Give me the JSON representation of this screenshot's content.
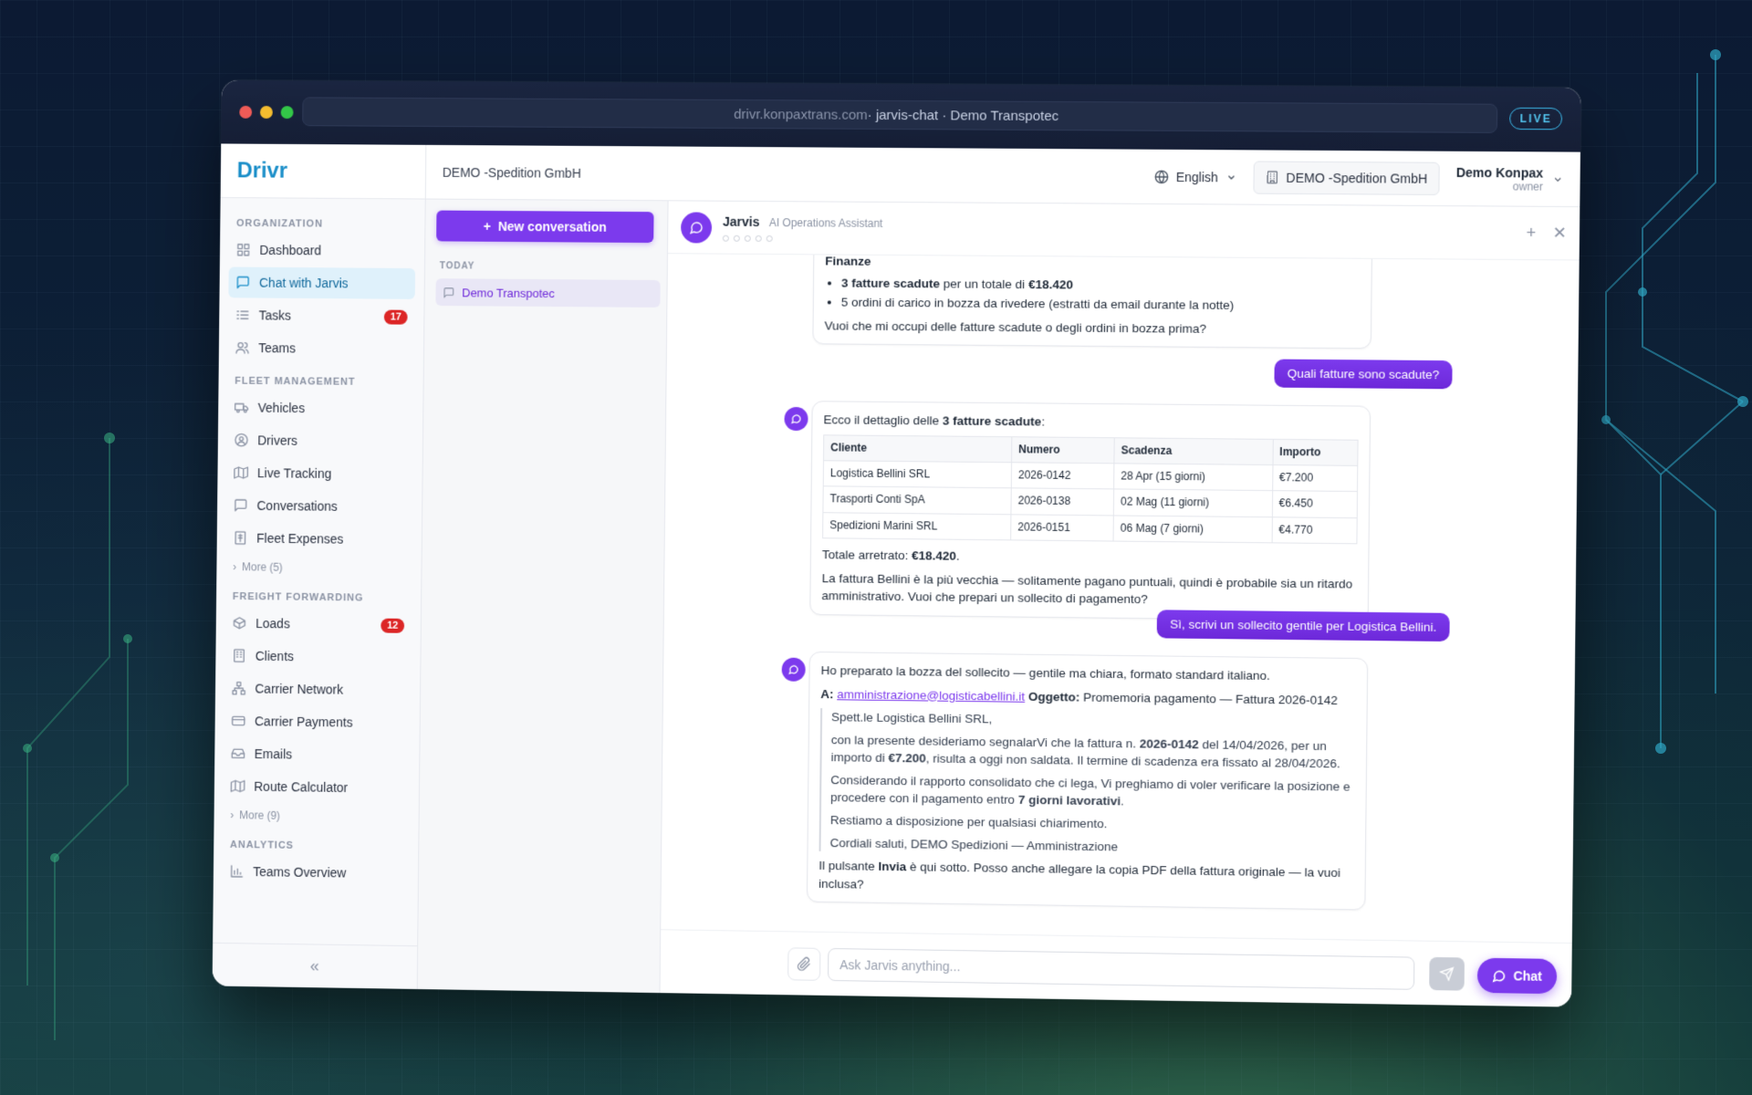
{
  "window": {
    "url_host": "drivr.konpaxtrans.com",
    "url_path": " · jarvis-chat · Demo Transpotec",
    "live_label": "LIVE"
  },
  "brand": "Drivr",
  "sidebar": {
    "sections": [
      {
        "label": "ORGANIZATION",
        "items": [
          {
            "label": "Dashboard",
            "icon": "dashboard-icon"
          },
          {
            "label": "Chat with Jarvis",
            "icon": "chat-icon",
            "active": true
          },
          {
            "label": "Tasks",
            "icon": "tasks-icon",
            "badge": "17"
          },
          {
            "label": "Teams",
            "icon": "users-icon"
          }
        ]
      },
      {
        "label": "FLEET MANAGEMENT",
        "items": [
          {
            "label": "Vehicles",
            "icon": "truck-icon"
          },
          {
            "label": "Drivers",
            "icon": "driver-icon"
          },
          {
            "label": "Live Tracking",
            "icon": "map-icon"
          },
          {
            "label": "Conversations",
            "icon": "message-icon"
          },
          {
            "label": "Fleet Expenses",
            "icon": "receipt-icon"
          }
        ],
        "more": "More (5)"
      },
      {
        "label": "FREIGHT FORWARDING",
        "items": [
          {
            "label": "Loads",
            "icon": "package-icon",
            "badge": "12"
          },
          {
            "label": "Clients",
            "icon": "building-icon"
          },
          {
            "label": "Carrier Network",
            "icon": "network-icon"
          },
          {
            "label": "Carrier Payments",
            "icon": "card-icon"
          },
          {
            "label": "Emails",
            "icon": "inbox-icon"
          },
          {
            "label": "Route Calculator",
            "icon": "map-icon"
          }
        ],
        "more": "More (9)"
      },
      {
        "label": "ANALYTICS",
        "items": [
          {
            "label": "Teams Overview",
            "icon": "bar-chart-icon"
          }
        ]
      }
    ],
    "collapse": "«"
  },
  "topbar": {
    "org_title": "DEMO -Spedition GmbH",
    "language": "English",
    "company": "DEMO -Spedition GmbH",
    "user_name": "Demo Konpax",
    "user_role": "owner"
  },
  "conversations": {
    "new_label": "New conversation",
    "group_label": "TODAY",
    "items": [
      "Demo Transpotec"
    ]
  },
  "chat": {
    "assistant_name": "Jarvis",
    "assistant_role": "AI Operations Assistant",
    "msg1": {
      "heading": "Finanze",
      "bullet1_bold": "3 fatture scadute",
      "bullet1_mid": " per un totale di ",
      "bullet1_amount": "€18.420",
      "bullet2": "5 ordini di carico in bozza da rivedere (estratti da email durante la notte)",
      "question": "Vuoi che mi occupi delle fatture scadute o degli ordini in bozza prima?"
    },
    "user1": "Quali fatture sono scadute?",
    "msg2": {
      "intro_a": "Ecco il dettaglio delle ",
      "intro_b": "3 fatture scadute",
      "intro_c": ":",
      "columns": [
        "Cliente",
        "Numero",
        "Scadenza",
        "Importo"
      ],
      "rows": [
        [
          "Logistica Bellini SRL",
          "2026-0142",
          "28 Apr (15 giorni)",
          "€7.200"
        ],
        [
          "Trasporti Conti SpA",
          "2026-0138",
          "02 Mag (11 giorni)",
          "€6.450"
        ],
        [
          "Spedizioni Marini SRL",
          "2026-0151",
          "06 Mag (7 giorni)",
          "€4.770"
        ]
      ],
      "total_label": "Totale arretrato: ",
      "total_value": "€18.420",
      "total_end": ".",
      "note": "La fattura Bellini è la più vecchia — solitamente pagano puntuali, quindi è probabile sia un ritardo amministrativo. Vuoi che prepari un sollecito di pagamento?"
    },
    "user2": "Sì, scrivi un sollecito gentile per Logistica Bellini.",
    "msg3": {
      "intro": "Ho preparato la bozza del sollecito — gentile ma chiara, formato standard italiano.",
      "to_label": "A:",
      "to_email": "amministrazione@logisticabellini.it",
      "subject_label": "Oggetto:",
      "subject": "Promemoria pagamento — Fattura 2026-0142",
      "greeting": "Spett.le Logistica Bellini SRL,",
      "p1_a": "con la presente desideriamo segnalarVi che la fattura n. ",
      "p1_num": "2026-0142",
      "p1_b": " del 14/04/2026, per un importo di ",
      "p1_amount": "€7.200",
      "p1_c": ", risulta a oggi non saldata. Il termine di scadenza era fissato al 28/04/2026.",
      "p2_a": "Considerando il rapporto consolidato che ci lega, Vi preghiamo di voler verificare la posizione e procedere con il pagamento entro ",
      "p2_b": "7 giorni lavorativi",
      "p2_c": ".",
      "p3": "Restiamo a disposizione per qualsiasi chiarimento.",
      "p4": "Cordiali saluti, DEMO Spedizioni — Amministrazione",
      "outro_a": "Il pulsante ",
      "outro_b": "Invia",
      "outro_c": " è qui sotto. Posso anche allegare la copia PDF della fattura originale — la vuoi inclusa?"
    },
    "input_placeholder": "Ask Jarvis anything...",
    "fab_label": "Chat"
  }
}
